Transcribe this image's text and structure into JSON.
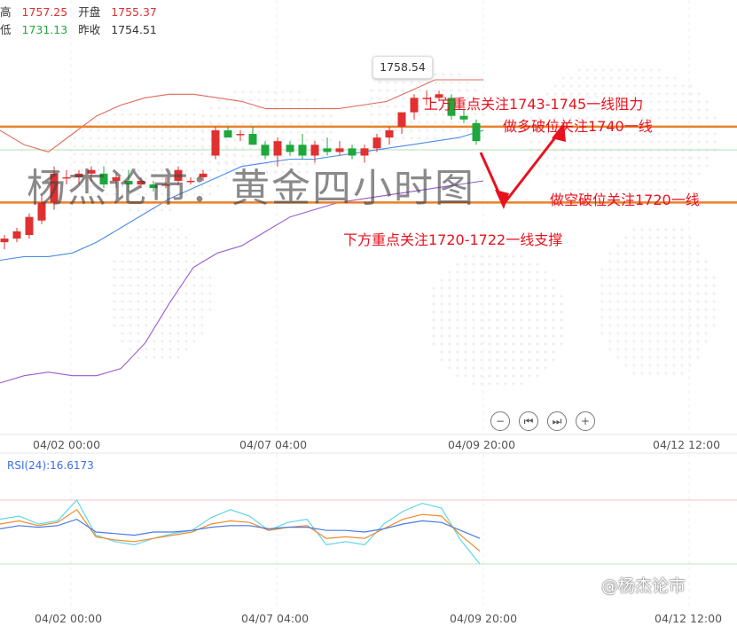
{
  "ohlc": {
    "high_label": "高",
    "high_value": "1757.25",
    "open_label": "开盘",
    "open_value": "1755.37",
    "low_label": "低",
    "low_value": "1731.13",
    "prev_close_label": "昨收",
    "prev_close_value": "1754.51"
  },
  "watermark": "杨杰论市：黄金四小时图",
  "tooltip_value": "1758.54",
  "annotations": {
    "upper_focus": "上方重点关注1743-1745一线阻力",
    "long_break": "做多破位关注1740一线",
    "short_break": "做空破位关注1720一线",
    "lower_focus": "下方重点关注1720-1722一线支撑"
  },
  "x_ticks": [
    "04/02 00:00",
    "04/07 04:00",
    "04/09 20:00",
    "04/12 12:00"
  ],
  "rsi_label": "RSI(24):16.6173",
  "brand": "@杨杰论市",
  "controls": [
    "zoom-out",
    "prev",
    "next",
    "zoom-in"
  ],
  "colors": {
    "up": "#e03030",
    "down": "#1ea83c",
    "level_line": "#e8812a",
    "annotation": "#e8121e",
    "boll_upper": "#e06a5a",
    "boll_middle": "#4a8ae8",
    "boll_lower": "#9b59d0"
  },
  "chart_data": {
    "type": "candlestick",
    "candles": [
      {
        "o": 1725,
        "h": 1727,
        "l": 1723,
        "c": 1726
      },
      {
        "o": 1726,
        "h": 1729,
        "l": 1725,
        "c": 1728
      },
      {
        "o": 1727,
        "h": 1733,
        "l": 1726,
        "c": 1732
      },
      {
        "o": 1731,
        "h": 1738,
        "l": 1730,
        "c": 1736
      },
      {
        "o": 1736,
        "h": 1746,
        "l": 1734,
        "c": 1744
      },
      {
        "o": 1743,
        "h": 1745,
        "l": 1741,
        "c": 1743
      },
      {
        "o": 1743,
        "h": 1745,
        "l": 1741,
        "c": 1744
      },
      {
        "o": 1744,
        "h": 1746,
        "l": 1742,
        "c": 1745
      },
      {
        "o": 1744,
        "h": 1746,
        "l": 1740,
        "c": 1741
      },
      {
        "o": 1742,
        "h": 1744,
        "l": 1740,
        "c": 1743
      },
      {
        "o": 1742,
        "h": 1745,
        "l": 1739,
        "c": 1741
      },
      {
        "o": 1741,
        "h": 1743,
        "l": 1740,
        "c": 1742
      },
      {
        "o": 1741,
        "h": 1742,
        "l": 1739,
        "c": 1740
      },
      {
        "o": 1741,
        "h": 1743,
        "l": 1740,
        "c": 1741
      },
      {
        "o": 1742,
        "h": 1746,
        "l": 1741,
        "c": 1745
      },
      {
        "o": 1742,
        "h": 1743,
        "l": 1741,
        "c": 1742
      },
      {
        "o": 1743,
        "h": 1745,
        "l": 1742,
        "c": 1744
      },
      {
        "o": 1749,
        "h": 1757,
        "l": 1748,
        "c": 1756
      },
      {
        "o": 1756,
        "h": 1757,
        "l": 1755,
        "c": 1754
      },
      {
        "o": 1755,
        "h": 1756,
        "l": 1753,
        "c": 1755
      },
      {
        "o": 1755,
        "h": 1757,
        "l": 1752,
        "c": 1752
      },
      {
        "o": 1752,
        "h": 1753,
        "l": 1748,
        "c": 1749
      },
      {
        "o": 1749,
        "h": 1754,
        "l": 1746,
        "c": 1753
      },
      {
        "o": 1752,
        "h": 1753,
        "l": 1749,
        "c": 1750
      },
      {
        "o": 1752,
        "h": 1755,
        "l": 1748,
        "c": 1749
      },
      {
        "o": 1749,
        "h": 1753,
        "l": 1747,
        "c": 1752
      },
      {
        "o": 1751,
        "h": 1754,
        "l": 1749,
        "c": 1750
      },
      {
        "o": 1750,
        "h": 1753,
        "l": 1749,
        "c": 1751
      },
      {
        "o": 1751,
        "h": 1752,
        "l": 1748,
        "c": 1749
      },
      {
        "o": 1749,
        "h": 1752,
        "l": 1747,
        "c": 1751
      },
      {
        "o": 1751,
        "h": 1755,
        "l": 1750,
        "c": 1754
      },
      {
        "o": 1754,
        "h": 1757,
        "l": 1752,
        "c": 1756
      },
      {
        "o": 1757,
        "h": 1760,
        "l": 1755,
        "c": 1761
      },
      {
        "o": 1761,
        "h": 1766,
        "l": 1759,
        "c": 1765
      },
      {
        "o": 1765,
        "h": 1767,
        "l": 1763,
        "c": 1765
      },
      {
        "o": 1765,
        "h": 1767,
        "l": 1764,
        "c": 1766
      },
      {
        "o": 1765,
        "h": 1766,
        "l": 1759,
        "c": 1760
      },
      {
        "o": 1760,
        "h": 1762,
        "l": 1758,
        "c": 1759
      },
      {
        "o": 1758,
        "h": 1759,
        "l": 1752,
        "c": 1753
      }
    ],
    "levels": [
      1757,
      1736
    ],
    "bollinger": {
      "upper": [
        1756,
        1752,
        1750,
        1755,
        1760,
        1763,
        1765,
        1766,
        1766,
        1765,
        1764,
        1762,
        1762,
        1762,
        1762,
        1763,
        1764,
        1767,
        1770,
        1770,
        1770
      ],
      "middle": [
        1720,
        1721,
        1721,
        1722,
        1725,
        1729,
        1733,
        1737,
        1740,
        1743,
        1746,
        1747,
        1748,
        1748,
        1749,
        1750,
        1751,
        1752,
        1753,
        1754,
        1756
      ],
      "lower": [
        1686,
        1688,
        1689,
        1688,
        1688,
        1690,
        1697,
        1708,
        1718,
        1722,
        1724,
        1728,
        1732,
        1734,
        1736,
        1737,
        1738,
        1739,
        1740,
        1741,
        1742
      ]
    },
    "rsi": {
      "cyan": [
        58,
        60,
        55,
        57,
        70,
        48,
        44,
        42,
        46,
        49,
        51,
        59,
        64,
        60,
        51,
        56,
        58,
        42,
        44,
        42,
        55,
        63,
        68,
        65,
        45,
        30
      ],
      "orange": [
        55,
        57,
        54,
        56,
        64,
        47,
        45,
        44,
        46,
        48,
        50,
        55,
        57,
        56,
        51,
        53,
        54,
        46,
        47,
        46,
        52,
        58,
        61,
        60,
        48,
        38
      ],
      "blue": [
        52,
        54,
        53,
        54,
        58,
        50,
        49,
        48,
        50,
        50,
        51,
        53,
        54,
        54,
        52,
        53,
        53,
        51,
        51,
        50,
        52,
        55,
        57,
        56,
        51,
        46
      ],
      "overbought": 70,
      "oversold": 30
    }
  }
}
